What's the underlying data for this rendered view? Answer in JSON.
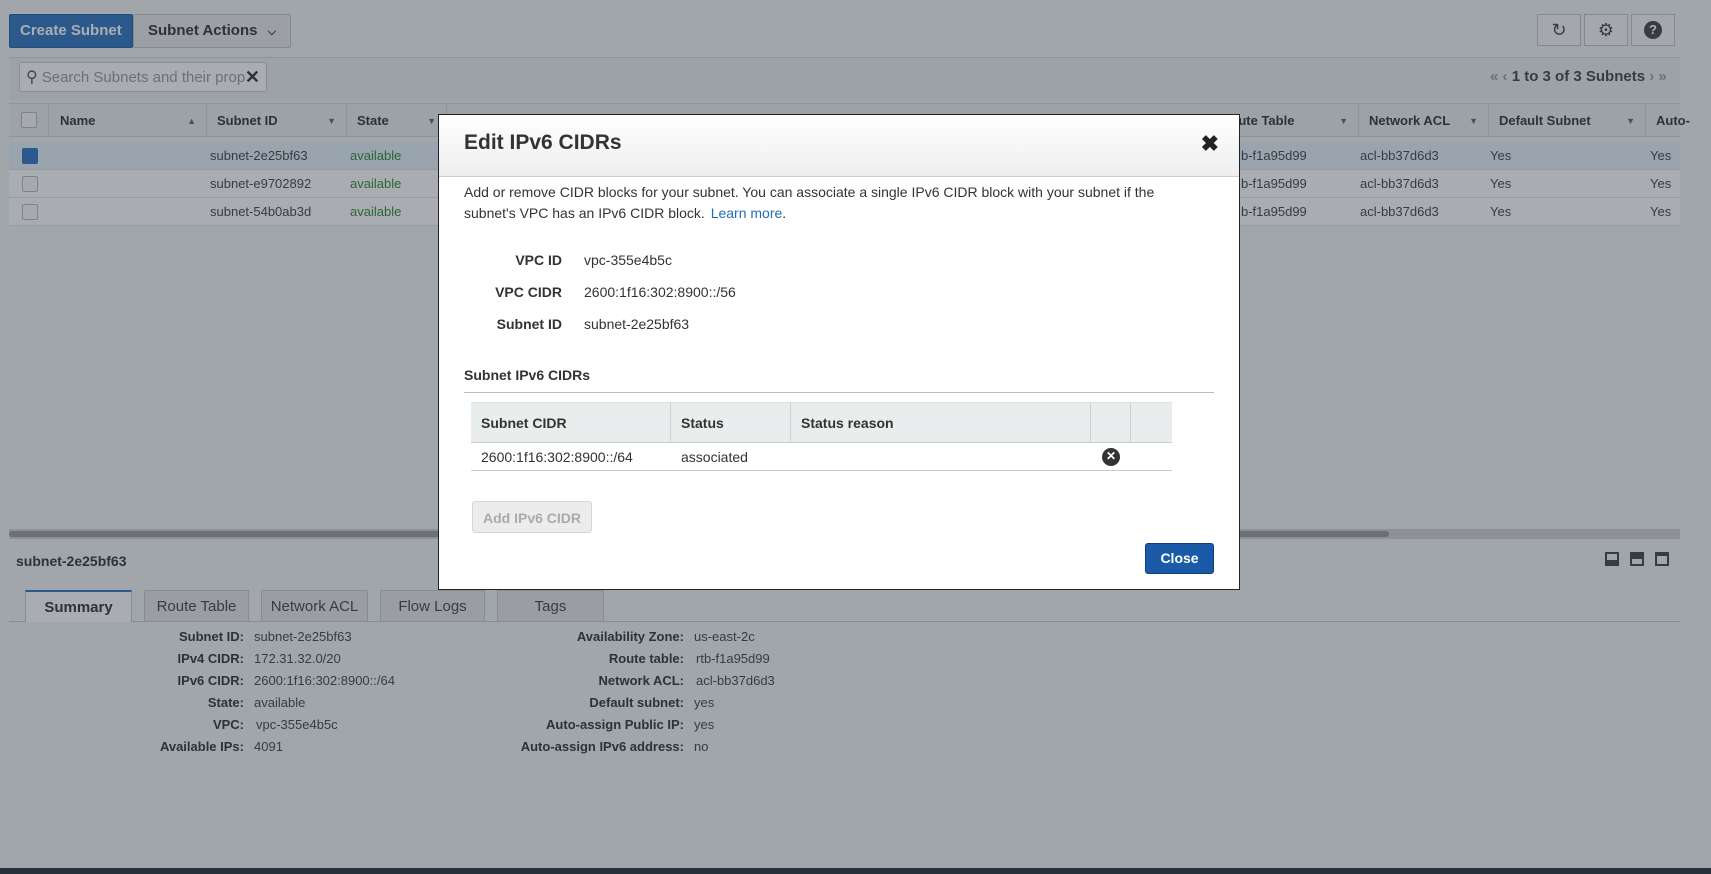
{
  "toolbar": {
    "create_label": "Create Subnet",
    "actions_label": "Subnet Actions",
    "refresh_icon": "refresh-icon",
    "settings_icon": "gear-icon",
    "help_icon": "help-icon"
  },
  "search": {
    "placeholder": "Search Subnets and their prop"
  },
  "pagination": {
    "text": "1 to 3 of 3 Subnets"
  },
  "grid": {
    "columns": [
      "Name",
      "Subnet ID",
      "State",
      "Route Table",
      "Network ACL",
      "Default Subnet",
      "Auto-"
    ],
    "rows": [
      {
        "name": "",
        "subnet_id": "subnet-2e25bf63",
        "state": "available",
        "route_table": "b-f1a95d99",
        "acl": "acl-bb37d6d3",
        "default": "Yes",
        "auto": "Yes",
        "selected": true
      },
      {
        "name": "",
        "subnet_id": "subnet-e9702892",
        "state": "available",
        "route_table": "b-f1a95d99",
        "acl": "acl-bb37d6d3",
        "default": "Yes",
        "auto": "Yes",
        "selected": false
      },
      {
        "name": "",
        "subnet_id": "subnet-54b0ab3d",
        "state": "available",
        "route_table": "b-f1a95d99",
        "acl": "acl-bb37d6d3",
        "default": "Yes",
        "auto": "Yes",
        "selected": false
      }
    ]
  },
  "details": {
    "title": "subnet-2e25bf63",
    "tabs": [
      "Summary",
      "Route Table",
      "Network ACL",
      "Flow Logs",
      "Tags"
    ],
    "left": [
      {
        "label": "Subnet ID:",
        "value": "subnet-2e25bf63"
      },
      {
        "label": "IPv4 CIDR:",
        "value": "172.31.32.0/20"
      },
      {
        "label": "IPv6 CIDR:",
        "value": "2600:1f16:302:8900::/64"
      },
      {
        "label": "State:",
        "value": "available"
      },
      {
        "label": "VPC:",
        "value": "vpc-355e4b5c"
      },
      {
        "label": "Available IPs:",
        "value": "4091"
      }
    ],
    "right": [
      {
        "label": "Availability Zone:",
        "value": "us-east-2c"
      },
      {
        "label": "Route table:",
        "value": "rtb-f1a95d99"
      },
      {
        "label": "Network ACL:",
        "value": "acl-bb37d6d3"
      },
      {
        "label": "Default subnet:",
        "value": "yes"
      },
      {
        "label": "Auto-assign Public IP:",
        "value": "yes"
      },
      {
        "label": "Auto-assign IPv6 address:",
        "value": "no"
      }
    ]
  },
  "modal": {
    "title": "Edit IPv6 CIDRs",
    "close_icon": "close-icon",
    "description_line1": "Add or remove CIDR blocks for your subnet. You can associate a single IPv6 CIDR block with your subnet if the",
    "description_line2": "subnet's VPC has an IPv6 CIDR block.",
    "learn_more": "Learn more",
    "period": ".",
    "vpc_id_label": "VPC ID",
    "vpc_id": "vpc-355e4b5c",
    "vpc_cidr_label": "VPC CIDR",
    "vpc_cidr": "2600:1f16:302:8900::/56",
    "subnet_id_label": "Subnet ID",
    "subnet_id": "subnet-2e25bf63",
    "section_title": "Subnet IPv6 CIDRs",
    "table_headers": [
      "Subnet CIDR",
      "Status",
      "Status reason"
    ],
    "table_rows": [
      {
        "cidr": "2600:1f16:302:8900::/64",
        "status": "associated",
        "reason": ""
      }
    ],
    "add_button": "Add IPv6 CIDR",
    "close_button": "Close"
  }
}
